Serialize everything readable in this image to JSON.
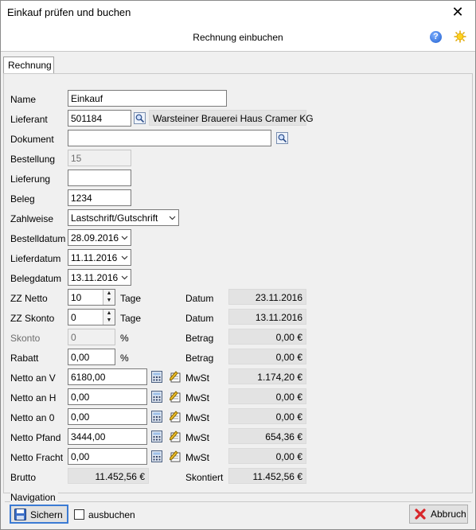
{
  "window": {
    "title": "Einkauf prüfen und buchen",
    "close": "✕"
  },
  "header": {
    "title": "Rechnung einbuchen"
  },
  "tabs": [
    "Rechnung"
  ],
  "form": {
    "name": {
      "label": "Name",
      "value": "Einkauf"
    },
    "lieferant": {
      "label": "Lieferant",
      "value": "501184",
      "display": "Warsteiner Brauerei Haus Cramer KG"
    },
    "dokument": {
      "label": "Dokument",
      "value": ""
    },
    "bestellung": {
      "label": "Bestellung",
      "value": "15"
    },
    "lieferung": {
      "label": "Lieferung",
      "value": ""
    },
    "beleg": {
      "label": "Beleg",
      "value": "1234"
    },
    "zahlweise": {
      "label": "Zahlweise",
      "value": "Lastschrift/Gutschrift"
    },
    "bestelldatum": {
      "label": "Bestelldatum",
      "value": "28.09.2016"
    },
    "lieferdatum": {
      "label": "Lieferdatum",
      "value": "11.11.2016"
    },
    "belegdatum": {
      "label": "Belegdatum",
      "value": "13.11.2016"
    },
    "zz_netto": {
      "label": "ZZ Netto",
      "value": "10",
      "unit": "Tage",
      "side_label": "Datum",
      "side_value": "23.11.2016"
    },
    "zz_skonto": {
      "label": "ZZ Skonto",
      "value": "0",
      "unit": "Tage",
      "side_label": "Datum",
      "side_value": "13.11.2016"
    },
    "skonto": {
      "label": "Skonto",
      "value": "0",
      "unit": "%",
      "side_label": "Betrag",
      "side_value": "0,00 €"
    },
    "rabatt": {
      "label": "Rabatt",
      "value": "0,00",
      "unit": "%",
      "side_label": "Betrag",
      "side_value": "0,00 €"
    },
    "netto_v": {
      "label": "Netto an V",
      "value": "6180,00",
      "side_label": "MwSt",
      "side_value": "1.174,20 €"
    },
    "netto_h": {
      "label": "Netto an H",
      "value": "0,00",
      "side_label": "MwSt",
      "side_value": "0,00 €"
    },
    "netto_0": {
      "label": "Netto an 0",
      "value": "0,00",
      "side_label": "MwSt",
      "side_value": "0,00 €"
    },
    "netto_pfand": {
      "label": "Netto Pfand",
      "value": "3444,00",
      "side_label": "MwSt",
      "side_value": "654,36 €"
    },
    "netto_fracht": {
      "label": "Netto Fracht",
      "value": "0,00",
      "side_label": "MwSt",
      "side_value": "0,00 €"
    },
    "brutto": {
      "label": "Brutto",
      "value": "11.452,56 €",
      "side_label": "Skontiert",
      "side_value": "11.452,56 €"
    }
  },
  "navigation": {
    "label": "Navigation",
    "save": "Sichern",
    "ausbuchen": "ausbuchen",
    "cancel": "Abbruch"
  }
}
